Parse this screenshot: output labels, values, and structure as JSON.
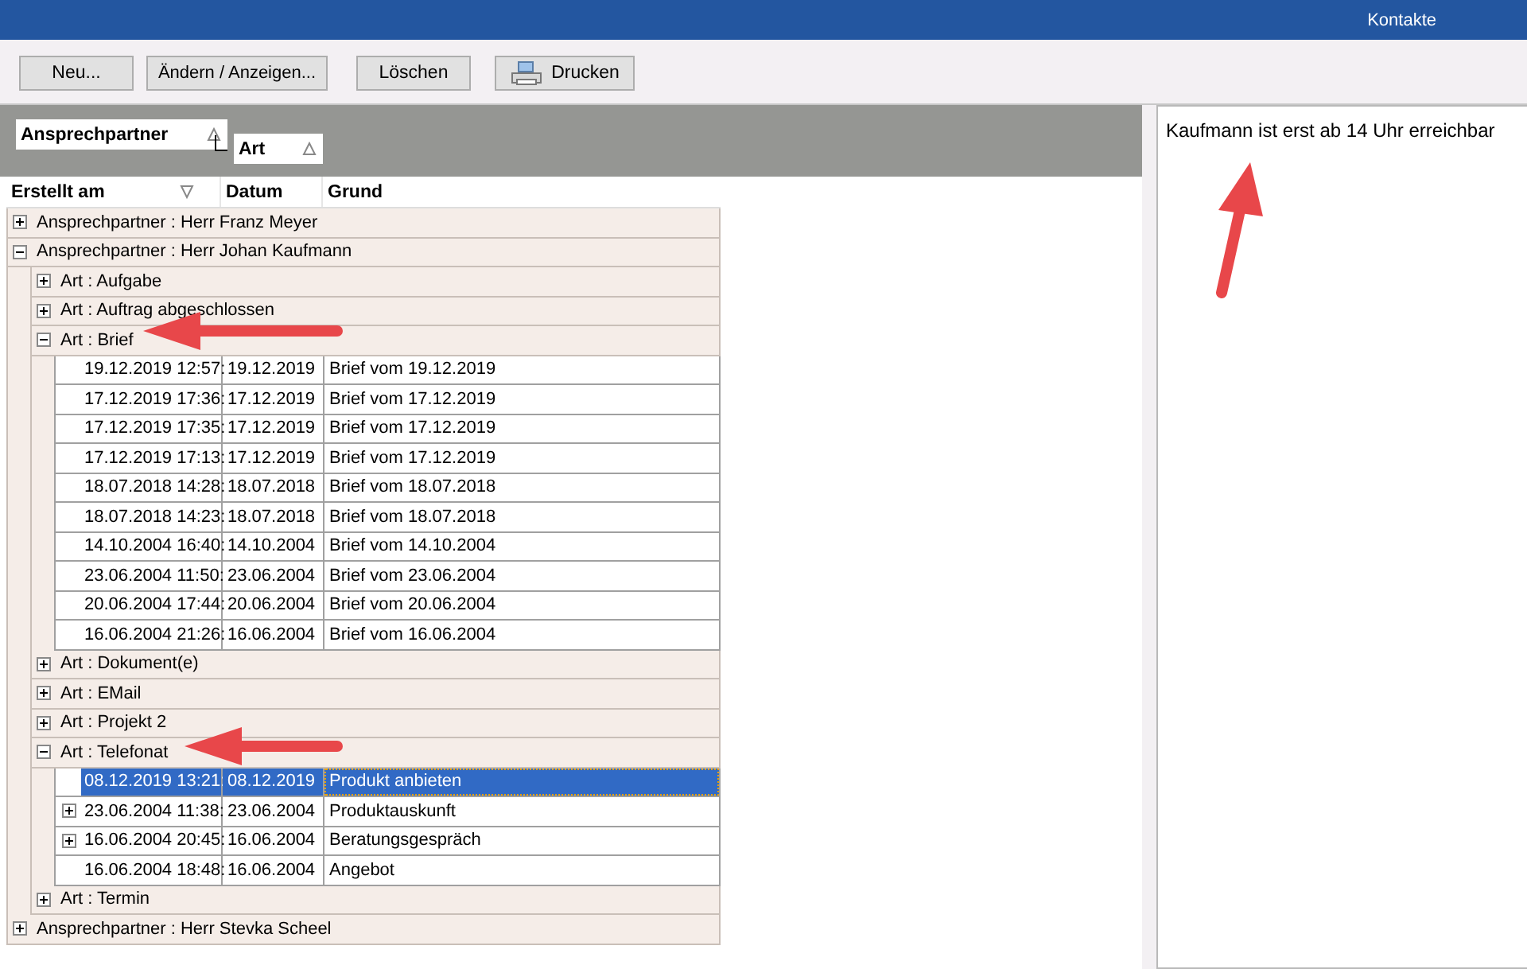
{
  "window": {
    "title": "Kontakte"
  },
  "toolbar": {
    "buttons": [
      {
        "label": "Neu...",
        "kind": "plain"
      },
      {
        "label": "Ändern / Anzeigen...",
        "kind": "plain"
      },
      {
        "label": "Löschen",
        "kind": "plain"
      },
      {
        "label": "Drucken",
        "kind": "print"
      }
    ]
  },
  "grouping": {
    "fields": [
      {
        "label": "Ansprechpartner",
        "sorted_descending": false
      },
      {
        "label": "Art",
        "sorted_descending": false
      }
    ]
  },
  "grid": {
    "columns": [
      {
        "label": "Erstellt am",
        "sorted_descending": true
      },
      {
        "label": "Datum"
      },
      {
        "label": "Grund"
      }
    ],
    "rows": [
      {
        "kind": "group",
        "label": "Ansprechpartner : Herr Franz Meyer",
        "expanded": false
      },
      {
        "kind": "group",
        "label": "Ansprechpartner : Herr Johan Kaufmann",
        "expanded": true,
        "children": [
          {
            "kind": "group",
            "label": "Art : Aufgabe",
            "expanded": false
          },
          {
            "kind": "group",
            "label": "Art : Auftrag abgeschlossen",
            "expanded": false
          },
          {
            "kind": "group",
            "label": "Art : Brief",
            "expanded": true,
            "children": [
              {
                "kind": "record",
                "cells": [
                  "19.12.2019 12:57:",
                  "19.12.2019",
                  "Brief vom 19.12.2019"
                ],
                "has_children": false,
                "selected": false
              },
              {
                "kind": "record",
                "cells": [
                  "17.12.2019 17:36:",
                  "17.12.2019",
                  "Brief vom 17.12.2019"
                ],
                "has_children": false,
                "selected": false
              },
              {
                "kind": "record",
                "cells": [
                  "17.12.2019 17:35:",
                  "17.12.2019",
                  "Brief vom 17.12.2019"
                ],
                "has_children": false,
                "selected": false
              },
              {
                "kind": "record",
                "cells": [
                  "17.12.2019 17:13:",
                  "17.12.2019",
                  "Brief vom 17.12.2019"
                ],
                "has_children": false,
                "selected": false
              },
              {
                "kind": "record",
                "cells": [
                  "18.07.2018 14:28:",
                  "18.07.2018",
                  "Brief vom 18.07.2018"
                ],
                "has_children": false,
                "selected": false
              },
              {
                "kind": "record",
                "cells": [
                  "18.07.2018 14:23:",
                  "18.07.2018",
                  "Brief vom 18.07.2018"
                ],
                "has_children": false,
                "selected": false
              },
              {
                "kind": "record",
                "cells": [
                  "14.10.2004 16:40:",
                  "14.10.2004",
                  "Brief vom 14.10.2004"
                ],
                "has_children": false,
                "selected": false
              },
              {
                "kind": "record",
                "cells": [
                  "23.06.2004 11:50:",
                  "23.06.2004",
                  "Brief vom 23.06.2004"
                ],
                "has_children": false,
                "selected": false
              },
              {
                "kind": "record",
                "cells": [
                  "20.06.2004 17:44:",
                  "20.06.2004",
                  "Brief vom 20.06.2004"
                ],
                "has_children": false,
                "selected": false
              },
              {
                "kind": "record",
                "cells": [
                  "16.06.2004 21:26:",
                  "16.06.2004",
                  "Brief vom 16.06.2004"
                ],
                "has_children": false,
                "selected": false
              }
            ]
          },
          {
            "kind": "group",
            "label": "Art : Dokument(e)",
            "expanded": false
          },
          {
            "kind": "group",
            "label": "Art : EMail",
            "expanded": false
          },
          {
            "kind": "group",
            "label": "Art : Projekt 2",
            "expanded": false
          },
          {
            "kind": "group",
            "label": "Art : Telefonat",
            "expanded": true,
            "children": [
              {
                "kind": "record",
                "cells": [
                  "08.12.2019 13:21:",
                  "08.12.2019",
                  "Produkt anbieten"
                ],
                "has_children": false,
                "selected": true
              },
              {
                "kind": "record",
                "cells": [
                  "23.06.2004 11:38:",
                  "23.06.2004",
                  "Produktauskunft"
                ],
                "has_children": true,
                "selected": false
              },
              {
                "kind": "record",
                "cells": [
                  "16.06.2004 20:45:",
                  "16.06.2004",
                  "Beratungsgespräch"
                ],
                "has_children": true,
                "selected": false
              },
              {
                "kind": "record",
                "cells": [
                  "16.06.2004 18:48:",
                  "16.06.2004",
                  "Angebot"
                ],
                "has_children": false,
                "selected": false
              }
            ]
          },
          {
            "kind": "group",
            "label": "Art : Termin",
            "expanded": false
          }
        ]
      },
      {
        "kind": "group",
        "label": "Ansprechpartner : Herr Stevka Scheel",
        "expanded": false
      }
    ]
  },
  "note": {
    "text": "Kaufmann ist erst ab 14 Uhr erreichbar"
  }
}
